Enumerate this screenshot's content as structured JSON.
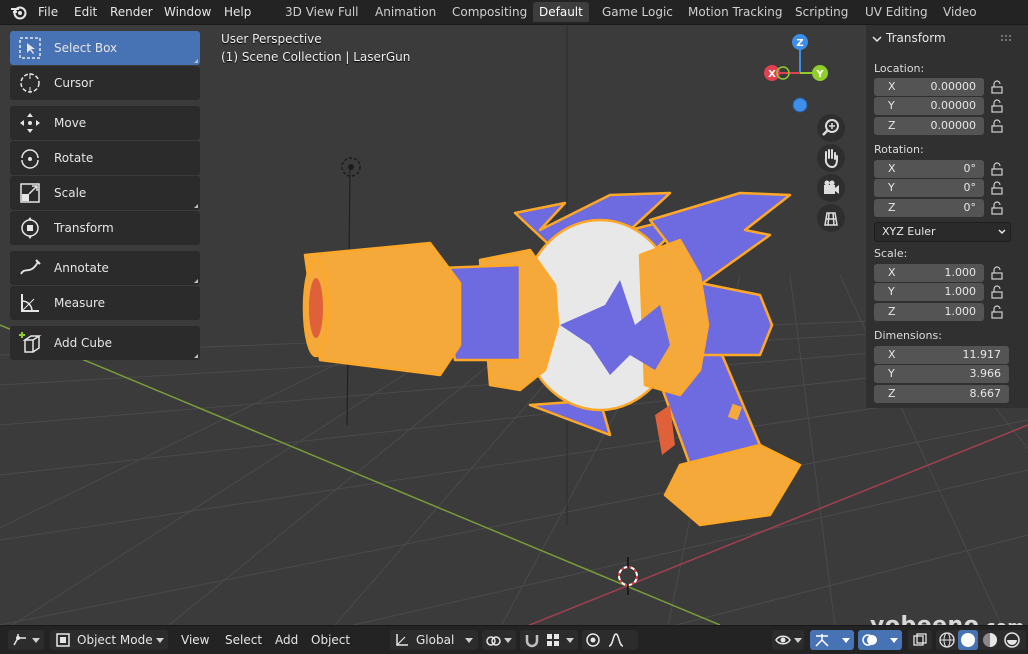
{
  "menubar": {
    "items": [
      "File",
      "Edit",
      "Render",
      "Window",
      "Help"
    ]
  },
  "workspaces": {
    "tabs": [
      "3D View Full",
      "Animation",
      "Compositing",
      "Default",
      "Game Logic",
      "Motion Tracking",
      "Scripting",
      "UV Editing",
      "Video Editing"
    ],
    "active": "Default"
  },
  "toolbar": {
    "tools": [
      {
        "label": "Select Box",
        "icon": "select-box-icon"
      },
      {
        "label": "Cursor",
        "icon": "cursor-icon"
      },
      {
        "label": "Move",
        "icon": "move-icon"
      },
      {
        "label": "Rotate",
        "icon": "rotate-icon"
      },
      {
        "label": "Scale",
        "icon": "scale-icon"
      },
      {
        "label": "Transform",
        "icon": "transform-icon"
      },
      {
        "label": "Annotate",
        "icon": "annotate-icon"
      },
      {
        "label": "Measure",
        "icon": "measure-icon"
      },
      {
        "label": "Add Cube",
        "icon": "add-cube-icon"
      }
    ]
  },
  "viewport": {
    "perspective": "User Perspective",
    "collection": "(1) Scene Collection | LaserGun",
    "gizmo": {
      "x": "X",
      "y": "Y",
      "z": "Z"
    },
    "nav_icons": [
      "zoom-icon",
      "hand-pan-icon",
      "camera-icon",
      "grid-view-icon"
    ]
  },
  "npanel": {
    "header": "Transform",
    "location_label": "Location:",
    "location": [
      {
        "axis": "X",
        "value": "0.00000"
      },
      {
        "axis": "Y",
        "value": "0.00000"
      },
      {
        "axis": "Z",
        "value": "0.00000"
      }
    ],
    "rotation_label": "Rotation:",
    "rotation": [
      {
        "axis": "X",
        "value": "0°"
      },
      {
        "axis": "Y",
        "value": "0°"
      },
      {
        "axis": "Z",
        "value": "0°"
      }
    ],
    "rotation_mode": "XYZ Euler",
    "scale_label": "Scale:",
    "scale": [
      {
        "axis": "X",
        "value": "1.000"
      },
      {
        "axis": "Y",
        "value": "1.000"
      },
      {
        "axis": "Z",
        "value": "1.000"
      }
    ],
    "dimensions_label": "Dimensions:",
    "dimensions": [
      {
        "axis": "X",
        "value": "11.917"
      },
      {
        "axis": "Y",
        "value": "3.966"
      },
      {
        "axis": "Z",
        "value": "8.667"
      }
    ]
  },
  "bottombar": {
    "mode": "Object Mode",
    "menus": [
      "View",
      "Select",
      "Add",
      "Object"
    ],
    "orientation": "Global"
  },
  "watermark": {
    "name": "yobeeno",
    "domain": ".com"
  },
  "colors": {
    "accent": "#4772b3",
    "model_orange": "#f4a93a",
    "model_purple": "#6e6be0",
    "selection_outline": "#ffa726",
    "axis_x": "#e04050",
    "axis_y": "#8fce2c",
    "axis_z": "#3c8ee8"
  }
}
